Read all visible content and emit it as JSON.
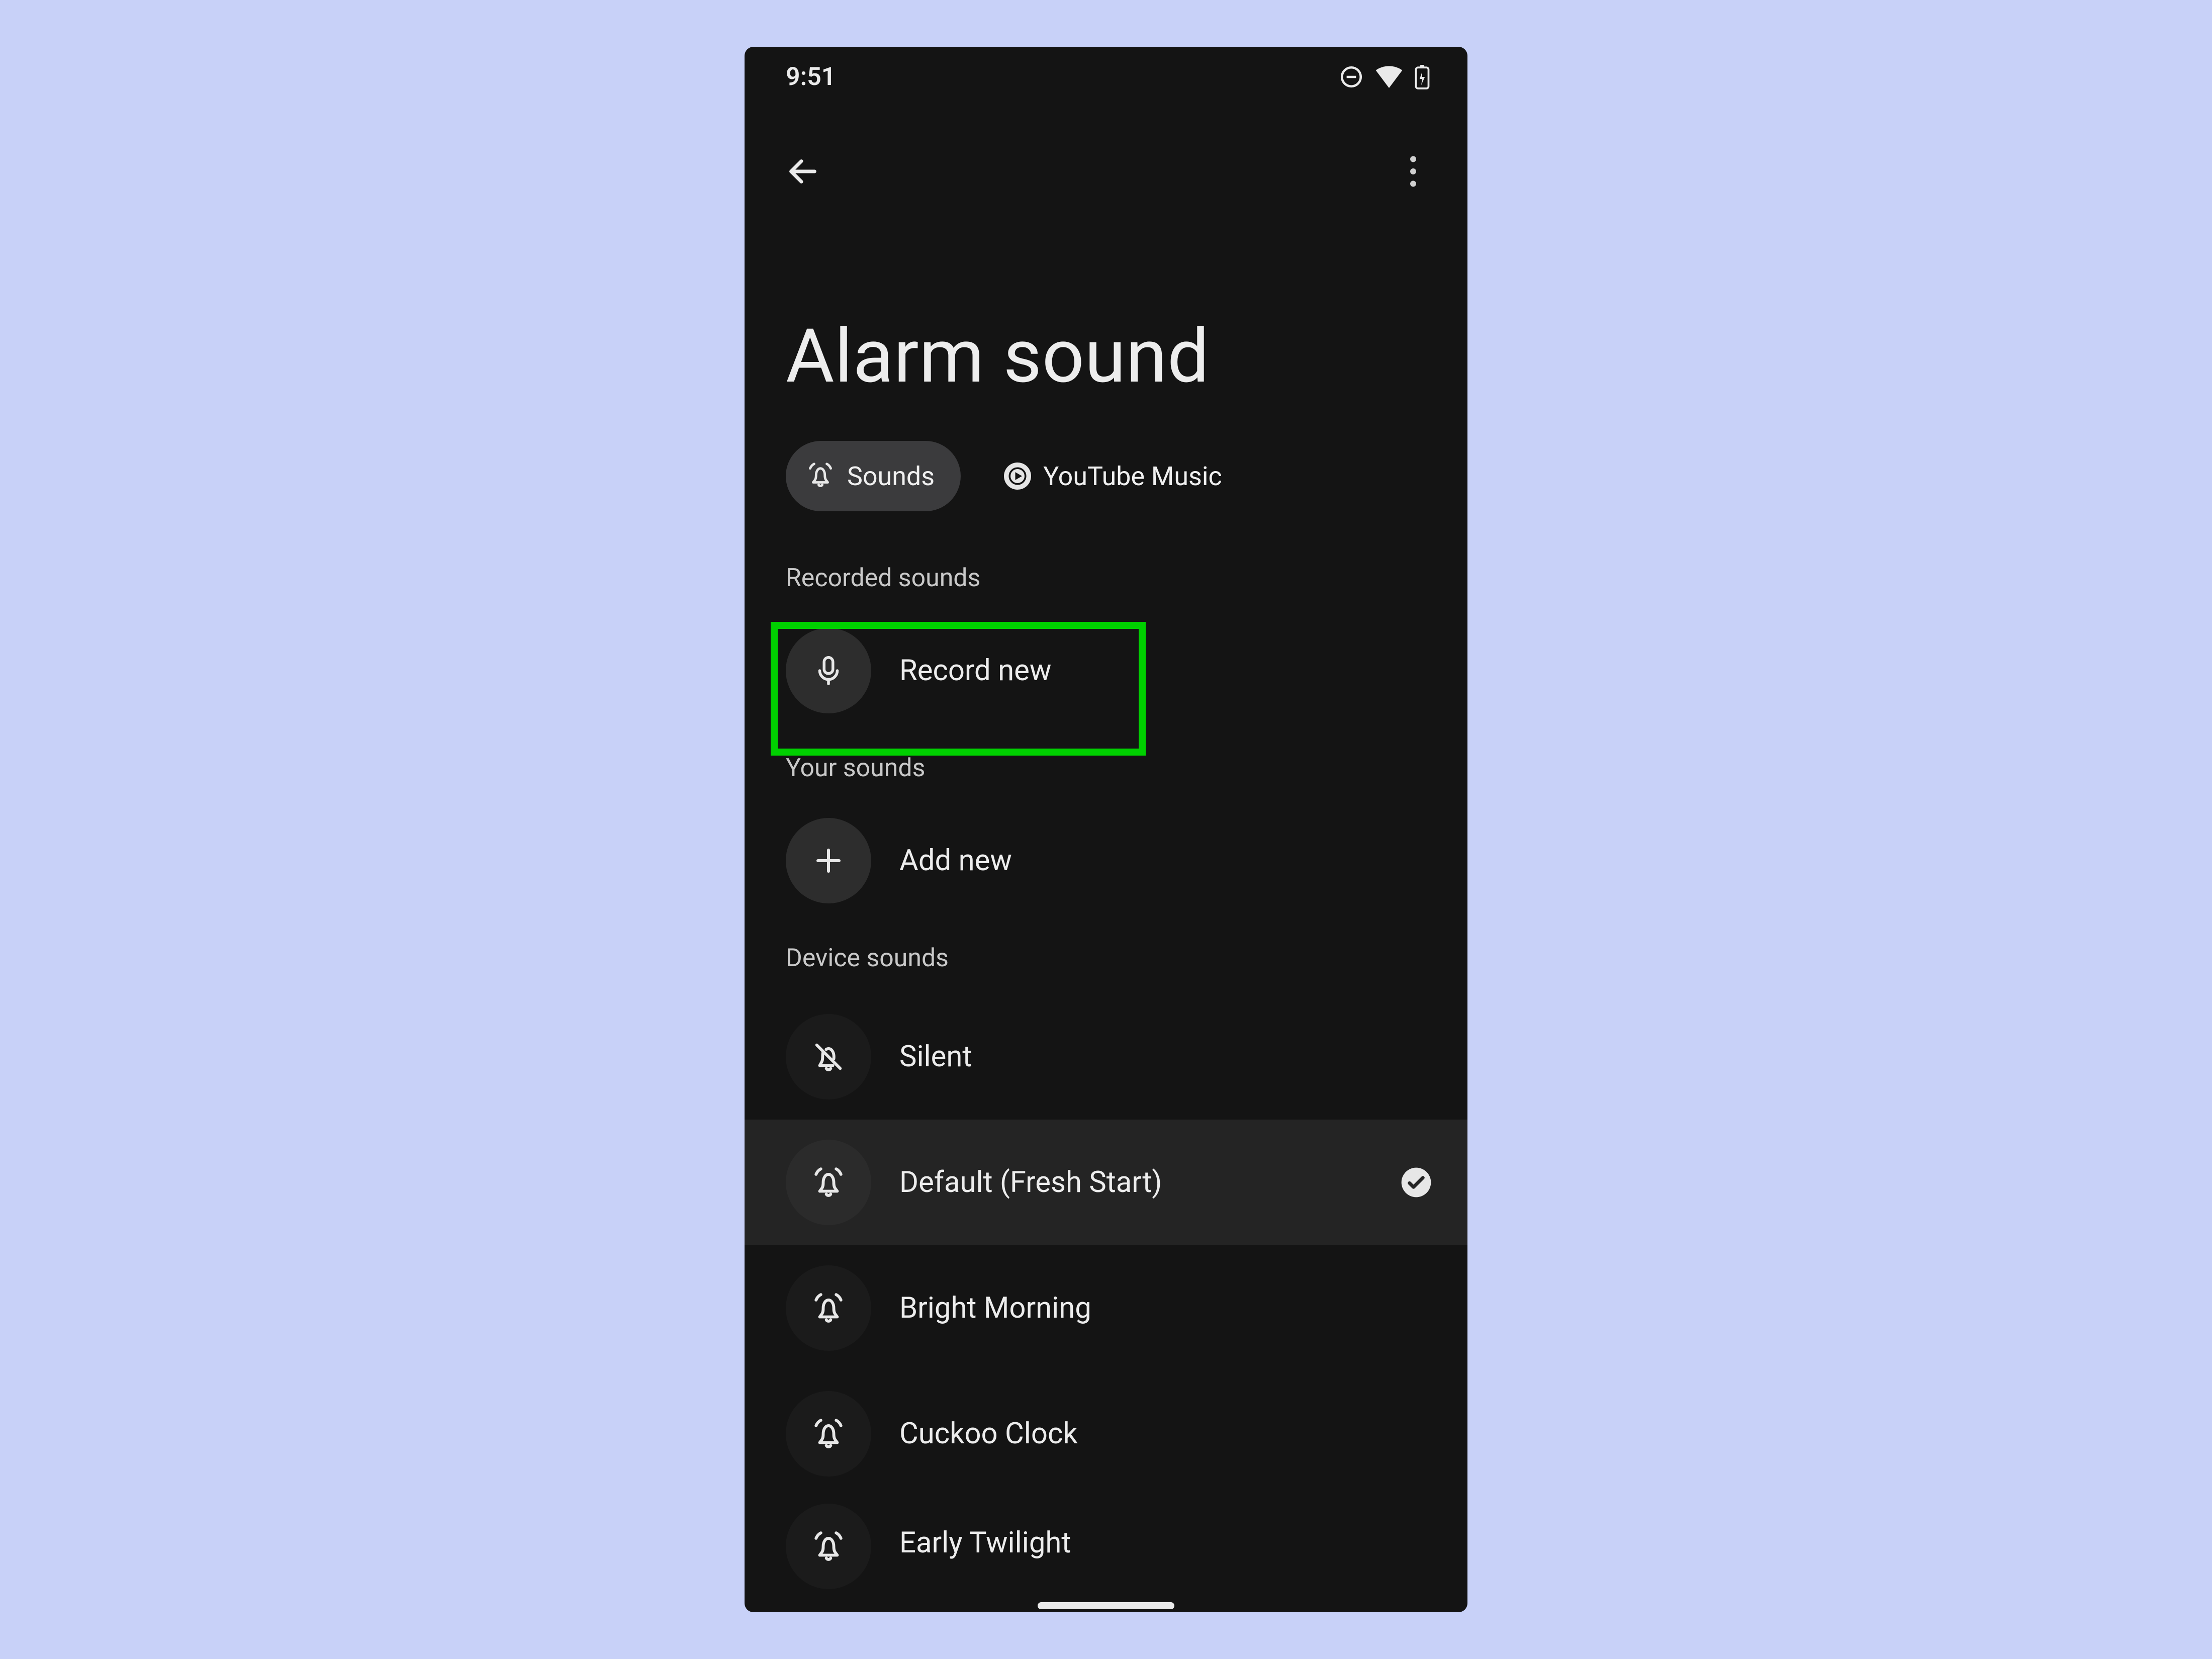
{
  "status": {
    "time": "9:51"
  },
  "page": {
    "title": "Alarm sound"
  },
  "chips": {
    "sounds": "Sounds",
    "youtube_music": "YouTube Music"
  },
  "sections": {
    "recorded": "Recorded sounds",
    "yours": "Your sounds",
    "device": "Device sounds"
  },
  "rows": {
    "record_new": "Record new",
    "add_new": "Add new",
    "silent": "Silent",
    "default": "Default (Fresh Start)",
    "bright": "Bright Morning",
    "cuckoo": "Cuckoo Clock",
    "early": "Early Twilight"
  },
  "highlight_color": "#00d000"
}
